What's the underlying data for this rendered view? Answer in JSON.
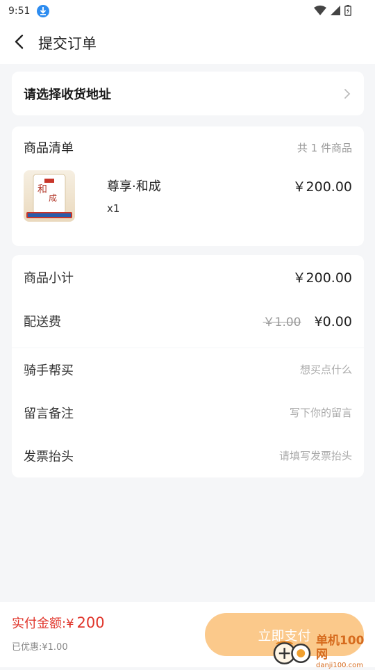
{
  "status_bar": {
    "time": "9:51"
  },
  "header": {
    "title": "提交订单"
  },
  "address": {
    "prompt": "请选择收货地址"
  },
  "goods": {
    "title": "商品清单",
    "count_text": "共 1 件商品",
    "items": [
      {
        "name": "尊享·和成",
        "qty": "x1",
        "price": "￥200.00"
      }
    ]
  },
  "summary": {
    "subtotal_label": "商品小计",
    "subtotal_value": "￥200.00",
    "delivery_label": "配送费",
    "delivery_original": "￥1.00",
    "delivery_value": "¥0.00"
  },
  "extras": {
    "rider_label": "骑手帮买",
    "rider_placeholder": "想买点什么",
    "note_label": "留言备注",
    "note_placeholder": "写下你的留言",
    "invoice_label": "发票抬头",
    "invoice_placeholder": "请填写发票抬头"
  },
  "footer": {
    "total_label": "实付金额:¥",
    "total_amount": "200",
    "discount_text": "已优惠:¥1.00",
    "pay_button": "立即支付"
  },
  "watermark": {
    "cn": "单机100网",
    "en": "danji100.com"
  },
  "colors": {
    "accent_button": "#fbc98b",
    "price_red": "#e0352b",
    "background": "#f5f6f8"
  }
}
